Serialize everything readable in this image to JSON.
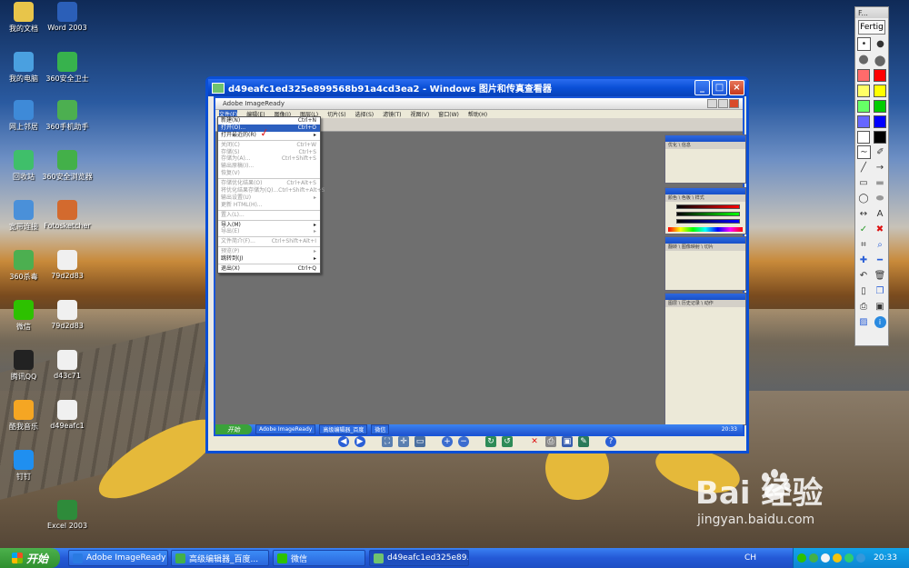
{
  "desktop_icons": [
    {
      "label": "我的文档",
      "icon": "my-documents-icon",
      "color": "#e8c54a"
    },
    {
      "label": "Word 2003",
      "icon": "word-icon",
      "color": "#2b5fb8"
    },
    {
      "label": "我的电脑",
      "icon": "my-computer-icon",
      "color": "#4aa0e0"
    },
    {
      "label": "360安全卫士",
      "icon": "360-security-icon",
      "color": "#37b24d"
    },
    {
      "label": "网上邻居",
      "icon": "network-icon",
      "color": "#3e8ad8"
    },
    {
      "label": "360手机助手",
      "icon": "360-phone-icon",
      "color": "#4caf50"
    },
    {
      "label": "回收站",
      "icon": "recycle-bin-icon",
      "color": "#3fbf6a"
    },
    {
      "label": "360安全浏览器",
      "icon": "360-browser-icon",
      "color": "#43b049"
    },
    {
      "label": "宽带连接",
      "icon": "broadband-icon",
      "color": "#4a90d9"
    },
    {
      "label": "Fotosketcher",
      "icon": "fotosketcher-icon",
      "color": "#d36a2e"
    },
    {
      "label": "360杀毒",
      "icon": "360-antivirus-icon",
      "color": "#4caf50"
    },
    {
      "label": "79d2d83",
      "icon": "image-file-icon",
      "color": "#f0f0f0"
    },
    {
      "label": "微信",
      "icon": "wechat-icon",
      "color": "#2dc100"
    },
    {
      "label": "79d2d83",
      "icon": "image-file-icon",
      "color": "#f0f0f0"
    },
    {
      "label": "腾讯QQ",
      "icon": "qq-icon",
      "color": "#222222"
    },
    {
      "label": "d43c71",
      "icon": "image-file-icon",
      "color": "#f0f0f0"
    },
    {
      "label": "酷我音乐",
      "icon": "kuwo-music-icon",
      "color": "#f5a623"
    },
    {
      "label": "d49eafc1",
      "icon": "image-file-icon",
      "color": "#f0f0f0"
    },
    {
      "label": "钉钉",
      "icon": "dingtalk-icon",
      "color": "#1f8ff0"
    },
    {
      "label": "Excel 2003",
      "icon": "excel-icon",
      "color": "#2e8b3a"
    }
  ],
  "viewer": {
    "title": "d49eafc1ed325e899568b91a4cd3ea2 - Windows 图片和传真查看器",
    "btn_min": "_",
    "btn_max": "□",
    "btn_close": "×"
  },
  "imageready": {
    "title": "Adobe ImageReady",
    "menus": [
      "文件(F)",
      "编辑(E)",
      "图像(I)",
      "图层(L)",
      "切片(S)",
      "选择(S)",
      "滤镜(T)",
      "视图(V)",
      "窗口(W)",
      "帮助(H)"
    ],
    "file_menu": [
      {
        "label": "新建(N)",
        "shortcut": "Ctrl+N",
        "state": "normal"
      },
      {
        "label": "打开(O)...",
        "shortcut": "Ctrl+O",
        "state": "highlight"
      },
      {
        "label": "打开最近的(R)",
        "shortcut": "▸",
        "state": "normal"
      },
      {
        "sep": true
      },
      {
        "label": "关闭(C)",
        "shortcut": "Ctrl+W",
        "state": "dim"
      },
      {
        "label": "存储(S)",
        "shortcut": "Ctrl+S",
        "state": "dim"
      },
      {
        "label": "存储为(A)...",
        "shortcut": "Ctrl+Shift+S",
        "state": "dim"
      },
      {
        "label": "输出原稿(I)...",
        "shortcut": "",
        "state": "dim"
      },
      {
        "label": "恢复(V)",
        "shortcut": "",
        "state": "dim"
      },
      {
        "sep": true
      },
      {
        "label": "存储优化结果(O)",
        "shortcut": "Ctrl+Alt+S",
        "state": "dim"
      },
      {
        "label": "将优化结果存储为(Q)...",
        "shortcut": "Ctrl+Shift+Alt+S",
        "state": "dim"
      },
      {
        "label": "输出设置(U)",
        "shortcut": "▸",
        "state": "dim"
      },
      {
        "label": "更新 HTML(H)...",
        "shortcut": "",
        "state": "dim"
      },
      {
        "sep": true
      },
      {
        "label": "置入(L)...",
        "shortcut": "",
        "state": "dim"
      },
      {
        "sep": true
      },
      {
        "label": "导入(M)",
        "shortcut": "▸",
        "state": "normal"
      },
      {
        "label": "导出(E)",
        "shortcut": "▸",
        "state": "dim"
      },
      {
        "sep": true
      },
      {
        "label": "文件简介(F)...",
        "shortcut": "Ctrl+Shift+Alt+I",
        "state": "dim"
      },
      {
        "sep": true
      },
      {
        "label": "预览(P)",
        "shortcut": "▸",
        "state": "dim"
      },
      {
        "label": "跳转到(J)",
        "shortcut": "▸",
        "state": "normal"
      },
      {
        "sep": true
      },
      {
        "label": "退出(X)",
        "shortcut": "Ctrl+Q",
        "state": "normal"
      }
    ],
    "taskbar": {
      "start": "开始",
      "items": [
        "Adobe ImageReady",
        "高级编辑器_百度",
        "微信"
      ],
      "clock": "20:33"
    }
  },
  "right_toolbar": {
    "header": "F...",
    "fertig": "Fertig",
    "colors": [
      "#ff6b6b",
      "#ff0000",
      "#ffff66",
      "#ffff00",
      "#66ff66",
      "#00cc00",
      "#6666ff",
      "#0000ff",
      "#ffffff",
      "#000000"
    ],
    "text_tool": "A"
  },
  "taskbar": {
    "start_label": "开始",
    "items": [
      {
        "label": "Adobe ImageReady",
        "icon": "imageready-icon",
        "color": "#2a7ae2"
      },
      {
        "label": "高级编辑器_百度...",
        "icon": "browser-icon",
        "color": "#43b049"
      },
      {
        "label": "微信",
        "icon": "wechat-icon",
        "color": "#2dc100"
      },
      {
        "label": "d49eafc1ed325e89...",
        "icon": "image-viewer-icon",
        "color": "#6fc36f"
      }
    ],
    "lang": "CH",
    "clock": "20:33"
  },
  "watermark": {
    "brand": "Bai  经验",
    "url": "jingyan.baidu.com"
  }
}
